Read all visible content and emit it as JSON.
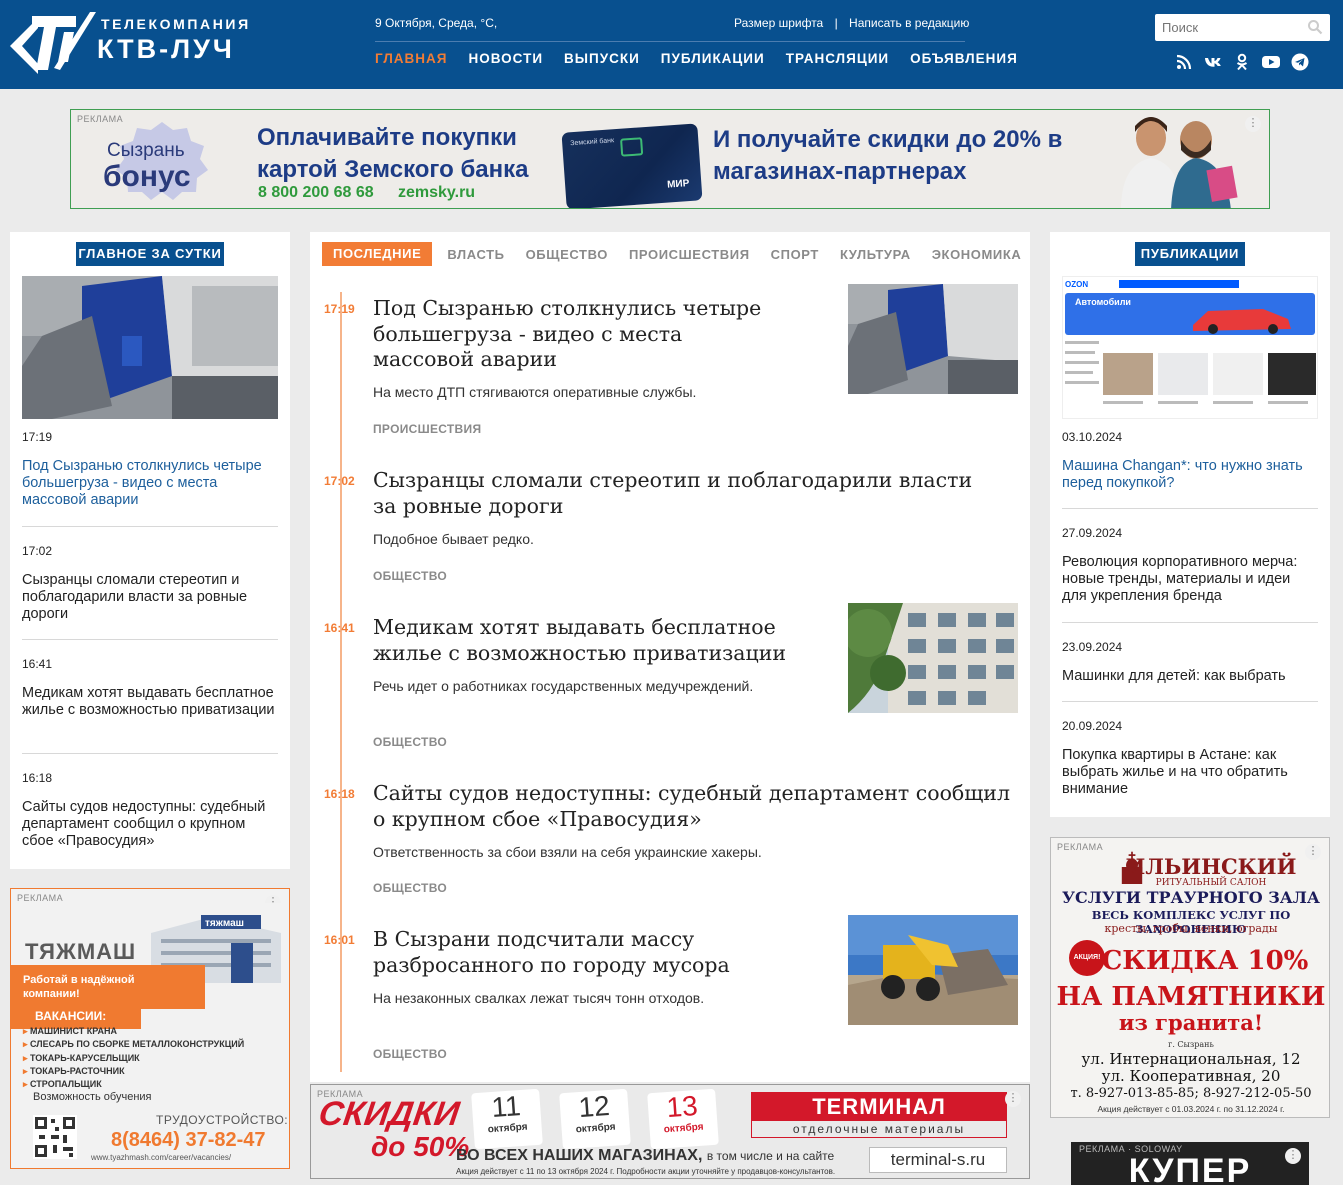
{
  "header": {
    "logo_sub": "ТЕЛЕКОМПАНИЯ",
    "logo_main": "КТВ-ЛУЧ",
    "date": "9 Октября, Среда, °C,",
    "font_size_link": "Размер шрифта",
    "separator": "|",
    "write_link": "Написать в редакцию",
    "nav": [
      "ГЛАВНАЯ",
      "НОВОСТИ",
      "ВЫПУСКИ",
      "ПУБЛИКАЦИИ",
      "ТРАНСЛЯЦИИ",
      "ОБЪЯВЛЕНИЯ"
    ],
    "search_placeholder": "Поиск",
    "socials": [
      "rss-icon",
      "vk-icon",
      "ok-icon",
      "youtube-icon",
      "telegram-icon"
    ]
  },
  "banner_top": {
    "label": "РЕКЛАМА",
    "brand_line1": "Сызрань",
    "brand_line2": "бонус",
    "headline1": "Оплачивайте покупки картой Земского банка",
    "phone": "8 800 200 68 68",
    "site": "zemsky.ru",
    "card_bank": "Земский банк",
    "card_system": "МИР",
    "headline2": "И получайте скидки до 20% в магазинах-партнерах",
    "menu": "⋮"
  },
  "left": {
    "title": "ГЛАВНОЕ ЗА СУТКИ",
    "items": [
      {
        "time": "17:19",
        "title": "Под Сызранью столкнулись четыре большегруза - видео с места массовой аварии"
      },
      {
        "time": "17:02",
        "title": "Сызранцы сломали стереотип и поблагодарили власти за ровные дороги"
      },
      {
        "time": "16:41",
        "title": "Медикам хотят выдавать бесплатное жилье с возможностью приватизации"
      },
      {
        "time": "16:18",
        "title": "Сайты судов недоступны: судебный департамент сообщил о крупном сбое «Правосудия»"
      }
    ]
  },
  "left_ad": {
    "label": "РЕКЛАМА",
    "logo": "ТЯЖМАШ",
    "building_sign": "тяжмаш",
    "work": "Работай в надёжной компании!",
    "vacancies_title": "ВАКАНСИИ:",
    "vacancies": [
      "МАШИНИСТ КРАНА",
      "СЛЕСАРЬ ПО СБОРКЕ МЕТАЛЛОКОНСТРУКЦИЙ",
      "ТОКАРЬ-КАРУСЕЛЬЩИК",
      "ТОКАРЬ-РАСТОЧНИК",
      "СТРОПАЛЬЩИК"
    ],
    "option": "Возможность обучения",
    "job": "ТРУДОУСТРОЙСТВО:",
    "phone": "8(8464) 37-82-47",
    "url": "www.tyazhmash.com/career/vacancies/",
    "menu": "⋮"
  },
  "center": {
    "tabs": [
      "ПОСЛЕДНИЕ НОВОСТИ",
      "ВЛАСТЬ",
      "ОБЩЕСТВО",
      "ПРОИСШЕСТВИЯ",
      "СПОРТ",
      "КУЛЬТУРА",
      "ЭКОНОМИКА"
    ],
    "news": [
      {
        "time": "17:19",
        "title": "Под Сызранью столкнулись четыре большегруза - видео с места массовой аварии",
        "lead": "На место ДТП стягиваются оперативные службы.",
        "category": "ПРОИСШЕСТВИЯ"
      },
      {
        "time": "17:02",
        "title": "Сызранцы сломали стереотип и поблагодарили власти за ровные дороги",
        "lead": "Подобное бывает редко.",
        "category": "ОБЩЕСТВО"
      },
      {
        "time": "16:41",
        "title": "Медикам хотят выдавать бесплатное жилье с возможностью приватизации",
        "lead": "Речь идет о работниках государственных медучреждений.",
        "category": "ОБЩЕСТВО"
      },
      {
        "time": "16:18",
        "title": "Сайты судов недоступны: судебный департамент сообщил о крупном сбое «Правосудия»",
        "lead": "Ответственность за сбои взяли на себя украинские хакеры.",
        "category": "ОБЩЕСТВО"
      },
      {
        "time": "16:01",
        "title": "В Сызрани подсчитали массу разбросанного по городу мусора",
        "lead": "На незаконных свалках лежат тысяч тонн отходов.",
        "category": "ОБЩЕСТВО"
      }
    ]
  },
  "center_ad": {
    "label": "РЕКЛАМА",
    "discount": "СКИДКИ",
    "discount2": "до 50%",
    "dates": [
      {
        "day": "11",
        "month": "октября"
      },
      {
        "day": "12",
        "month": "октября"
      },
      {
        "day": "13",
        "month": "октября"
      }
    ],
    "brand": "TERМИНАЛ",
    "brand_sub": "отделочные материалы",
    "all_stores": "ВО ВСЕХ НАШИХ МАГАЗИНАХ,",
    "all_stores_small": "в том числе и на сайте",
    "site": "terminal-s.ru",
    "note": "Акция действует с 11 по 13 октября 2024 г. Подробности акции уточняйте у продавцов-консультантов.",
    "menu": "⋮"
  },
  "right": {
    "title": "ПУБЛИКАЦИИ",
    "image_brand": "OZON",
    "image_heading": "Автомобили",
    "items": [
      {
        "date": "03.10.2024",
        "title": "Машина Changan*: что нужно знать перед покупкой?"
      },
      {
        "date": "27.09.2024",
        "title": "Революция корпоративного мерча: новые тренды, материалы и идеи для укрепления бренда"
      },
      {
        "date": "23.09.2024",
        "title": "Машинки для детей: как выбрать"
      },
      {
        "date": "20.09.2024",
        "title": "Покупка квартиры в Астане: как выбрать жилье и на что обратить внимание"
      }
    ]
  },
  "right_ad": {
    "label": "РЕКЛАМА",
    "name": "ИЛЬИНСКИЙ",
    "sub": "РИТУАЛЬНЫЙ САЛОН",
    "hall": "УСЛУГИ ТРАУРНОГО ЗАЛА",
    "full": "ВЕСЬ КОМПЛЕКС УСЛУГ ПО ЗАХОРОНЕНИЮ",
    "items": "кресты, гробы, венки, ограды",
    "badge": "АКЦИЯ!",
    "sale": "СКИДКА 10%",
    "monuments": "НА ПАМЯТНИКИ",
    "granite": "из гранита!",
    "city": "г. Сызрань",
    "addr1": "ул. Интернациональная, 12",
    "addr2": "ул. Кооперативная, 20",
    "tel": "т. 8-927-013-85-85; 8-927-212-05-50",
    "date": "Акция действует с 01.03.2024 г. по 31.12.2024 г.",
    "menu": "⋮"
  },
  "right_ad2": {
    "label": "РЕКЛАМА · SOLOWAY",
    "text": "КУПЕР",
    "menu": "⋮"
  }
}
